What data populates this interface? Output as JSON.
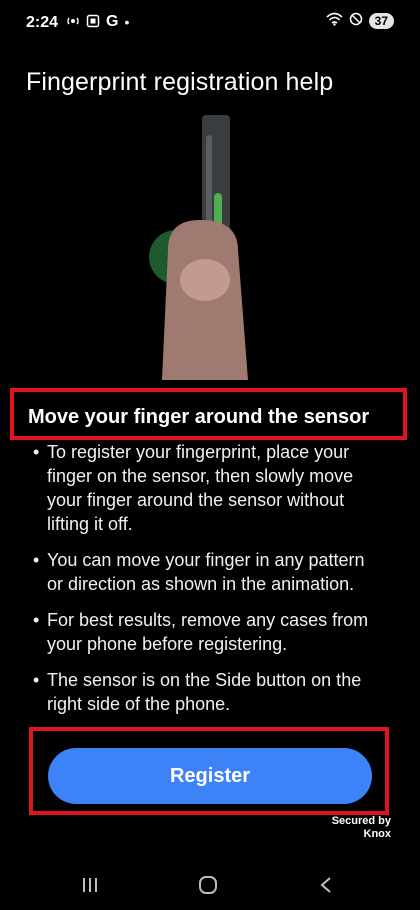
{
  "status_bar": {
    "time": "2:24",
    "left_icons": [
      "hotspot-icon",
      "screenshot-icon",
      "google-g-icon",
      "dot-icon"
    ],
    "g_label": "G",
    "dot": "•",
    "battery": "37"
  },
  "header": {
    "title": "Fingerprint registration help"
  },
  "section": {
    "heading": "Move your finger around the sensor",
    "items": [
      "To register your fingerprint, place your finger on the sensor, then slowly move your finger around the sensor without lifting it off.",
      "You can move your finger in any pattern or direction as shown in the animation.",
      "For best results, remove any cases from your phone before registering.",
      "The sensor is on the Side button on the right side of the phone."
    ],
    "bullet": "•"
  },
  "actions": {
    "register_label": "Register"
  },
  "footer": {
    "secured_line1": "Secured by",
    "secured_line2": "Knox"
  },
  "nav": {
    "recents_icon": "recents-icon",
    "home_icon": "home-icon",
    "back_icon": "back-icon"
  },
  "colors": {
    "background": "#000000",
    "accent": "#3e82f7",
    "highlight": "#e0141f",
    "sensor_green": "#4caf50"
  }
}
